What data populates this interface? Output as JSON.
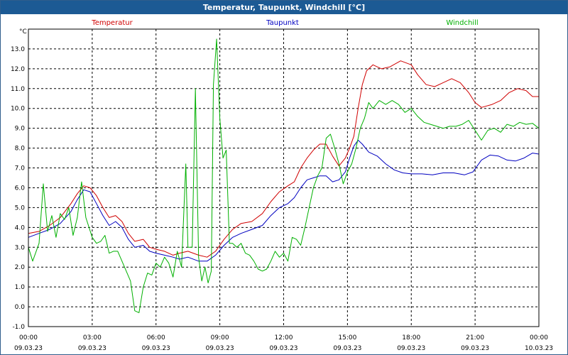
{
  "window": {
    "title": "Temperatur, Taupunkt, Windchill [°C]"
  },
  "chart_data": {
    "type": "line",
    "title": "Temperatur, Taupunkt, Windchill [°C]",
    "unit_label": "°C",
    "ylim": [
      -1.0,
      14.0
    ],
    "y_ticks": [
      "13.0",
      "12.0",
      "11.0",
      "10.0",
      "9.0",
      "8.0",
      "7.0",
      "6.0",
      "5.0",
      "4.0",
      "3.0",
      "2.0",
      "1.0",
      "0.0",
      "-1.0"
    ],
    "x_ticks": [
      {
        "time": "00:00",
        "date": "09.03.23"
      },
      {
        "time": "03:00",
        "date": "09.03.23"
      },
      {
        "time": "06:00",
        "date": "09.03.23"
      },
      {
        "time": "09:00",
        "date": "09.03.23"
      },
      {
        "time": "12:00",
        "date": "09.03.23"
      },
      {
        "time": "15:00",
        "date": "09.03.23"
      },
      {
        "time": "18:00",
        "date": "09.03.23"
      },
      {
        "time": "21:00",
        "date": "09.03.23"
      },
      {
        "time": "00:00",
        "date": "10.03.23"
      }
    ],
    "grid": true,
    "legend_position": "top",
    "x_hours_range": [
      0,
      24
    ],
    "series": [
      {
        "name": "Temperatur",
        "color": "#d00000",
        "points": [
          [
            0,
            3.7
          ],
          [
            0.5,
            3.8
          ],
          [
            1.0,
            4.1
          ],
          [
            1.5,
            4.5
          ],
          [
            2.0,
            5.2
          ],
          [
            2.3,
            5.7
          ],
          [
            2.6,
            6.1
          ],
          [
            2.9,
            6.0
          ],
          [
            3.2,
            5.6
          ],
          [
            3.5,
            5.0
          ],
          [
            3.8,
            4.5
          ],
          [
            4.1,
            4.6
          ],
          [
            4.4,
            4.3
          ],
          [
            4.7,
            3.7
          ],
          [
            5.0,
            3.3
          ],
          [
            5.4,
            3.4
          ],
          [
            5.7,
            3.0
          ],
          [
            6.0,
            2.9
          ],
          [
            6.4,
            2.8
          ],
          [
            6.8,
            2.6
          ],
          [
            7.1,
            2.7
          ],
          [
            7.5,
            2.8
          ],
          [
            8.0,
            2.6
          ],
          [
            8.4,
            2.5
          ],
          [
            8.8,
            2.8
          ],
          [
            9.2,
            3.4
          ],
          [
            9.6,
            3.9
          ],
          [
            10.0,
            4.2
          ],
          [
            10.5,
            4.3
          ],
          [
            11.0,
            4.7
          ],
          [
            11.4,
            5.3
          ],
          [
            11.8,
            5.8
          ],
          [
            12.2,
            6.1
          ],
          [
            12.5,
            6.3
          ],
          [
            12.8,
            7.0
          ],
          [
            13.1,
            7.5
          ],
          [
            13.4,
            7.9
          ],
          [
            13.7,
            8.2
          ],
          [
            14.0,
            8.2
          ],
          [
            14.3,
            7.6
          ],
          [
            14.6,
            7.1
          ],
          [
            14.9,
            7.5
          ],
          [
            15.1,
            8.0
          ],
          [
            15.3,
            8.6
          ],
          [
            15.5,
            10.0
          ],
          [
            15.7,
            11.2
          ],
          [
            15.9,
            11.9
          ],
          [
            16.2,
            12.2
          ],
          [
            16.6,
            12.0
          ],
          [
            17.0,
            12.1
          ],
          [
            17.5,
            12.4
          ],
          [
            18.0,
            12.2
          ],
          [
            18.3,
            11.7
          ],
          [
            18.7,
            11.2
          ],
          [
            19.1,
            11.1
          ],
          [
            19.5,
            11.3
          ],
          [
            19.9,
            11.5
          ],
          [
            20.3,
            11.3
          ],
          [
            20.7,
            10.8
          ],
          [
            21.0,
            10.3
          ],
          [
            21.3,
            10.05
          ],
          [
            21.8,
            10.2
          ],
          [
            22.2,
            10.4
          ],
          [
            22.6,
            10.8
          ],
          [
            23.0,
            11.0
          ],
          [
            23.4,
            10.9
          ],
          [
            23.7,
            10.6
          ],
          [
            24.0,
            10.6
          ]
        ]
      },
      {
        "name": "Taupunkt",
        "color": "#0000c0",
        "points": [
          [
            0,
            3.5
          ],
          [
            0.5,
            3.7
          ],
          [
            1.0,
            3.9
          ],
          [
            1.5,
            4.2
          ],
          [
            2.0,
            4.8
          ],
          [
            2.3,
            5.4
          ],
          [
            2.6,
            5.9
          ],
          [
            2.9,
            5.8
          ],
          [
            3.2,
            5.2
          ],
          [
            3.5,
            4.6
          ],
          [
            3.8,
            4.1
          ],
          [
            4.1,
            4.3
          ],
          [
            4.4,
            4.0
          ],
          [
            4.7,
            3.4
          ],
          [
            5.0,
            3.0
          ],
          [
            5.4,
            3.1
          ],
          [
            5.7,
            2.8
          ],
          [
            6.0,
            2.7
          ],
          [
            6.4,
            2.6
          ],
          [
            6.8,
            2.5
          ],
          [
            7.1,
            2.4
          ],
          [
            7.5,
            2.5
          ],
          [
            8.0,
            2.3
          ],
          [
            8.4,
            2.3
          ],
          [
            8.8,
            2.6
          ],
          [
            9.2,
            3.1
          ],
          [
            9.6,
            3.5
          ],
          [
            10.0,
            3.7
          ],
          [
            10.5,
            3.9
          ],
          [
            11.0,
            4.1
          ],
          [
            11.4,
            4.6
          ],
          [
            11.8,
            5.0
          ],
          [
            12.2,
            5.2
          ],
          [
            12.5,
            5.5
          ],
          [
            12.8,
            6.0
          ],
          [
            13.1,
            6.4
          ],
          [
            13.4,
            6.5
          ],
          [
            13.7,
            6.6
          ],
          [
            14.0,
            6.6
          ],
          [
            14.3,
            6.3
          ],
          [
            14.6,
            6.4
          ],
          [
            14.9,
            6.8
          ],
          [
            15.1,
            7.5
          ],
          [
            15.3,
            8.1
          ],
          [
            15.5,
            8.4
          ],
          [
            15.7,
            8.2
          ],
          [
            16.0,
            7.8
          ],
          [
            16.4,
            7.6
          ],
          [
            16.8,
            7.2
          ],
          [
            17.2,
            6.9
          ],
          [
            17.6,
            6.75
          ],
          [
            18.0,
            6.7
          ],
          [
            18.5,
            6.7
          ],
          [
            19.0,
            6.65
          ],
          [
            19.5,
            6.75
          ],
          [
            20.0,
            6.75
          ],
          [
            20.5,
            6.65
          ],
          [
            20.9,
            6.8
          ],
          [
            21.3,
            7.4
          ],
          [
            21.7,
            7.65
          ],
          [
            22.1,
            7.6
          ],
          [
            22.5,
            7.4
          ],
          [
            22.9,
            7.35
          ],
          [
            23.3,
            7.5
          ],
          [
            23.7,
            7.75
          ],
          [
            24.0,
            7.7
          ]
        ]
      },
      {
        "name": "Windchill",
        "color": "#00b000",
        "points": [
          [
            0,
            3.0
          ],
          [
            0.2,
            2.3
          ],
          [
            0.5,
            3.2
          ],
          [
            0.7,
            6.2
          ],
          [
            0.9,
            3.8
          ],
          [
            1.1,
            4.6
          ],
          [
            1.3,
            3.5
          ],
          [
            1.5,
            4.7
          ],
          [
            1.7,
            4.4
          ],
          [
            1.9,
            5.0
          ],
          [
            2.1,
            3.6
          ],
          [
            2.3,
            4.5
          ],
          [
            2.5,
            6.3
          ],
          [
            2.7,
            4.5
          ],
          [
            3.0,
            3.5
          ],
          [
            3.2,
            3.2
          ],
          [
            3.4,
            3.3
          ],
          [
            3.6,
            3.6
          ],
          [
            3.8,
            2.7
          ],
          [
            4.0,
            2.8
          ],
          [
            4.2,
            2.8
          ],
          [
            4.4,
            2.3
          ],
          [
            4.6,
            1.8
          ],
          [
            4.8,
            1.3
          ],
          [
            5.0,
            -0.2
          ],
          [
            5.2,
            -0.3
          ],
          [
            5.4,
            1.0
          ],
          [
            5.6,
            1.7
          ],
          [
            5.8,
            1.6
          ],
          [
            6.0,
            2.2
          ],
          [
            6.2,
            2.0
          ],
          [
            6.4,
            2.5
          ],
          [
            6.6,
            2.2
          ],
          [
            6.8,
            1.5
          ],
          [
            7.0,
            2.8
          ],
          [
            7.2,
            2.0
          ],
          [
            7.4,
            7.2
          ],
          [
            7.5,
            3.0
          ],
          [
            7.7,
            3.0
          ],
          [
            7.85,
            11.0
          ],
          [
            8.0,
            2.5
          ],
          [
            8.15,
            1.3
          ],
          [
            8.3,
            2.0
          ],
          [
            8.45,
            1.2
          ],
          [
            8.6,
            1.8
          ],
          [
            8.7,
            11.2
          ],
          [
            8.85,
            13.5
          ],
          [
            9.0,
            9.5
          ],
          [
            9.15,
            7.5
          ],
          [
            9.3,
            7.9
          ],
          [
            9.45,
            3.2
          ],
          [
            9.6,
            3.2
          ],
          [
            9.8,
            3.0
          ],
          [
            10.0,
            3.2
          ],
          [
            10.2,
            2.7
          ],
          [
            10.4,
            2.6
          ],
          [
            10.6,
            2.3
          ],
          [
            10.8,
            1.9
          ],
          [
            11.0,
            1.8
          ],
          [
            11.2,
            1.9
          ],
          [
            11.4,
            2.3
          ],
          [
            11.6,
            2.8
          ],
          [
            11.8,
            2.5
          ],
          [
            12.0,
            2.7
          ],
          [
            12.2,
            2.3
          ],
          [
            12.4,
            3.5
          ],
          [
            12.6,
            3.4
          ],
          [
            12.8,
            3.1
          ],
          [
            13.0,
            4.0
          ],
          [
            13.2,
            5.0
          ],
          [
            13.4,
            6.0
          ],
          [
            13.6,
            6.6
          ],
          [
            13.8,
            7.0
          ],
          [
            14.0,
            8.5
          ],
          [
            14.2,
            8.7
          ],
          [
            14.4,
            8.0
          ],
          [
            14.6,
            7.2
          ],
          [
            14.8,
            6.2
          ],
          [
            15.0,
            6.8
          ],
          [
            15.2,
            7.2
          ],
          [
            15.4,
            8.0
          ],
          [
            15.6,
            9.0
          ],
          [
            15.8,
            9.5
          ],
          [
            16.0,
            10.3
          ],
          [
            16.2,
            10.0
          ],
          [
            16.5,
            10.4
          ],
          [
            16.8,
            10.2
          ],
          [
            17.1,
            10.4
          ],
          [
            17.4,
            10.2
          ],
          [
            17.7,
            9.8
          ],
          [
            18.0,
            10.0
          ],
          [
            18.3,
            9.6
          ],
          [
            18.6,
            9.3
          ],
          [
            18.9,
            9.2
          ],
          [
            19.2,
            9.1
          ],
          [
            19.5,
            9.0
          ],
          [
            19.8,
            9.1
          ],
          [
            20.1,
            9.1
          ],
          [
            20.4,
            9.2
          ],
          [
            20.7,
            9.4
          ],
          [
            21.0,
            8.9
          ],
          [
            21.3,
            8.4
          ],
          [
            21.6,
            8.9
          ],
          [
            21.9,
            9.0
          ],
          [
            22.2,
            8.8
          ],
          [
            22.5,
            9.2
          ],
          [
            22.8,
            9.1
          ],
          [
            23.1,
            9.3
          ],
          [
            23.4,
            9.2
          ],
          [
            23.7,
            9.25
          ],
          [
            24.0,
            9.0
          ]
        ]
      }
    ]
  }
}
